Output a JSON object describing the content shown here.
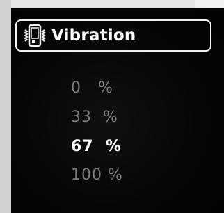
{
  "screen": {
    "title": "Vibration",
    "title_icon": "phone-vibrate-icon",
    "options": [
      {
        "label": "0   %",
        "selected": false
      },
      {
        "label": "33  %",
        "selected": false
      },
      {
        "label": "67  %",
        "selected": true
      },
      {
        "label": "100 %",
        "selected": false
      }
    ],
    "colors": {
      "background": "#050505",
      "selected_text": "#ffffff",
      "unselected_text": "#7a7a7a",
      "frame": "#f0f0f0"
    }
  }
}
